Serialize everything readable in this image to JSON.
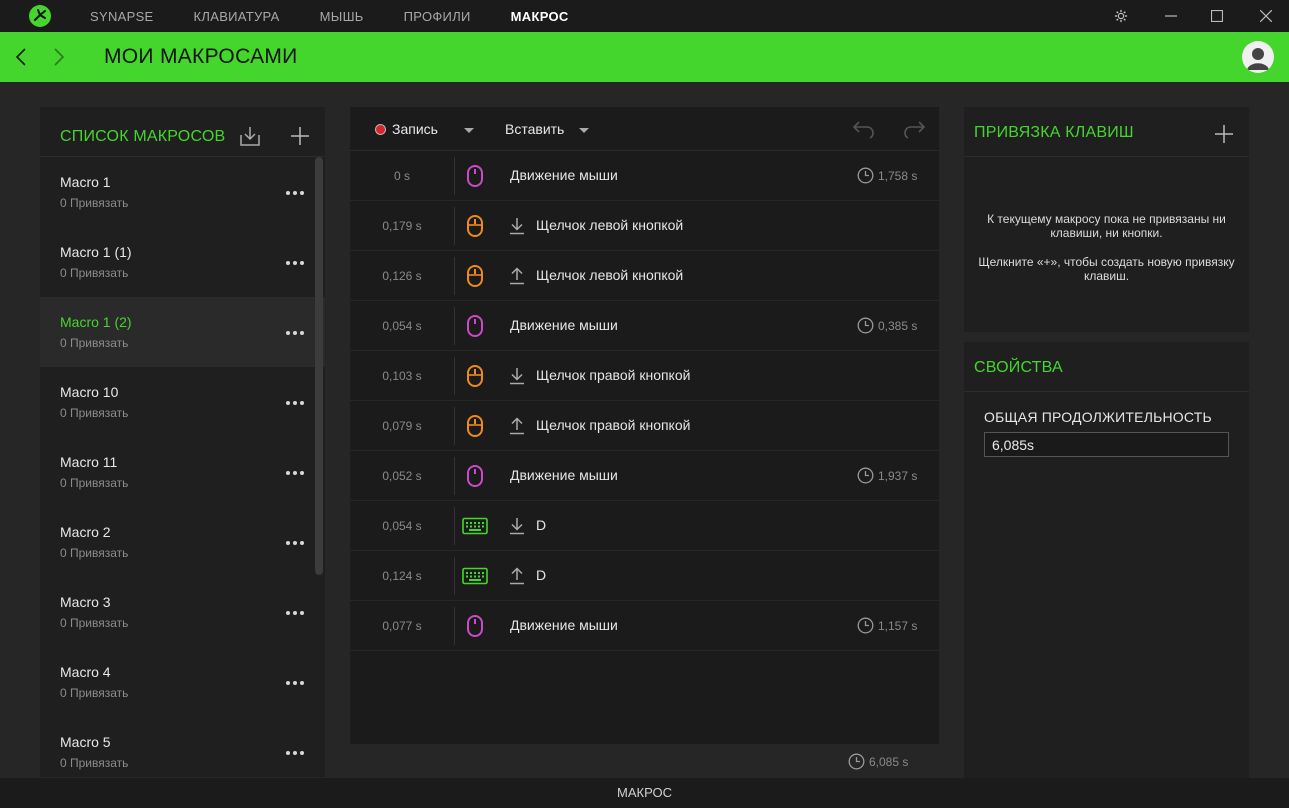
{
  "nav": {
    "tabs": [
      {
        "label": "SYNAPSE"
      },
      {
        "label": "КЛАВИАТУРА"
      },
      {
        "label": "МЫШЬ"
      },
      {
        "label": "ПРОФИЛИ"
      },
      {
        "label": "МАКРОС"
      }
    ],
    "active_index": 4
  },
  "header": {
    "title": "МОИ МАКРОСАМИ"
  },
  "colors": {
    "accent": "#44d62c",
    "mouse_move": "#c94bc9",
    "mouse_click": "#f08a1c",
    "keyboard": "#44d62c",
    "record": "#d9262c"
  },
  "macro_list": {
    "title": "СПИСОК МАКРОСОВ",
    "items": [
      {
        "name": "Macro 1",
        "sub": "0 Привязать"
      },
      {
        "name": "Macro 1 (1)",
        "sub": "0 Привязать"
      },
      {
        "name": "Macro 1 (2)",
        "sub": "0 Привязать"
      },
      {
        "name": "Macro 10",
        "sub": "0 Привязать"
      },
      {
        "name": "Macro 11",
        "sub": "0 Привязать"
      },
      {
        "name": "Macro 2",
        "sub": "0 Привязать"
      },
      {
        "name": "Macro 3",
        "sub": "0 Привязать"
      },
      {
        "name": "Macro 4",
        "sub": "0 Привязать"
      },
      {
        "name": "Macro 5",
        "sub": "0 Привязать"
      }
    ],
    "selected_index": 2
  },
  "editor": {
    "record_label": "Запись",
    "insert_label": "Вставить",
    "rows": [
      {
        "delay": "0 s",
        "type": "mouse-move",
        "direction": "",
        "label": "Движение мыши",
        "duration": "1,758 s"
      },
      {
        "delay": "0,179 s",
        "type": "mouse-click",
        "direction": "down",
        "label": "Щелчок левой кнопкой",
        "duration": ""
      },
      {
        "delay": "0,126 s",
        "type": "mouse-click",
        "direction": "up",
        "label": "Щелчок левой кнопкой",
        "duration": ""
      },
      {
        "delay": "0,054 s",
        "type": "mouse-move",
        "direction": "",
        "label": "Движение мыши",
        "duration": "0,385 s"
      },
      {
        "delay": "0,103 s",
        "type": "mouse-click",
        "direction": "down",
        "label": "Щелчок правой кнопкой",
        "duration": ""
      },
      {
        "delay": "0,079 s",
        "type": "mouse-click",
        "direction": "up",
        "label": "Щелчок правой кнопкой",
        "duration": ""
      },
      {
        "delay": "0,052 s",
        "type": "mouse-move",
        "direction": "",
        "label": "Движение мыши",
        "duration": "1,937 s"
      },
      {
        "delay": "0,054 s",
        "type": "keyboard",
        "direction": "down",
        "label": "D",
        "duration": ""
      },
      {
        "delay": "0,124 s",
        "type": "keyboard",
        "direction": "up",
        "label": "D",
        "duration": ""
      },
      {
        "delay": "0,077 s",
        "type": "mouse-move",
        "direction": "",
        "label": "Движение мыши",
        "duration": "1,157 s"
      }
    ],
    "total": "6,085 s"
  },
  "binding": {
    "title": "ПРИВЯЗКА КЛАВИШ",
    "message1": "К текущему макросу пока не привязаны ни клавиши, ни кнопки.",
    "message2": "Щелкните «+», чтобы создать новую привязку клавиш."
  },
  "properties": {
    "title": "СВОЙСТВА",
    "duration_label": "ОБЩАЯ ПРОДОЛЖИТЕЛЬНОСТЬ",
    "duration_value": "6,085s"
  },
  "status": {
    "label": "МАКРОС"
  }
}
